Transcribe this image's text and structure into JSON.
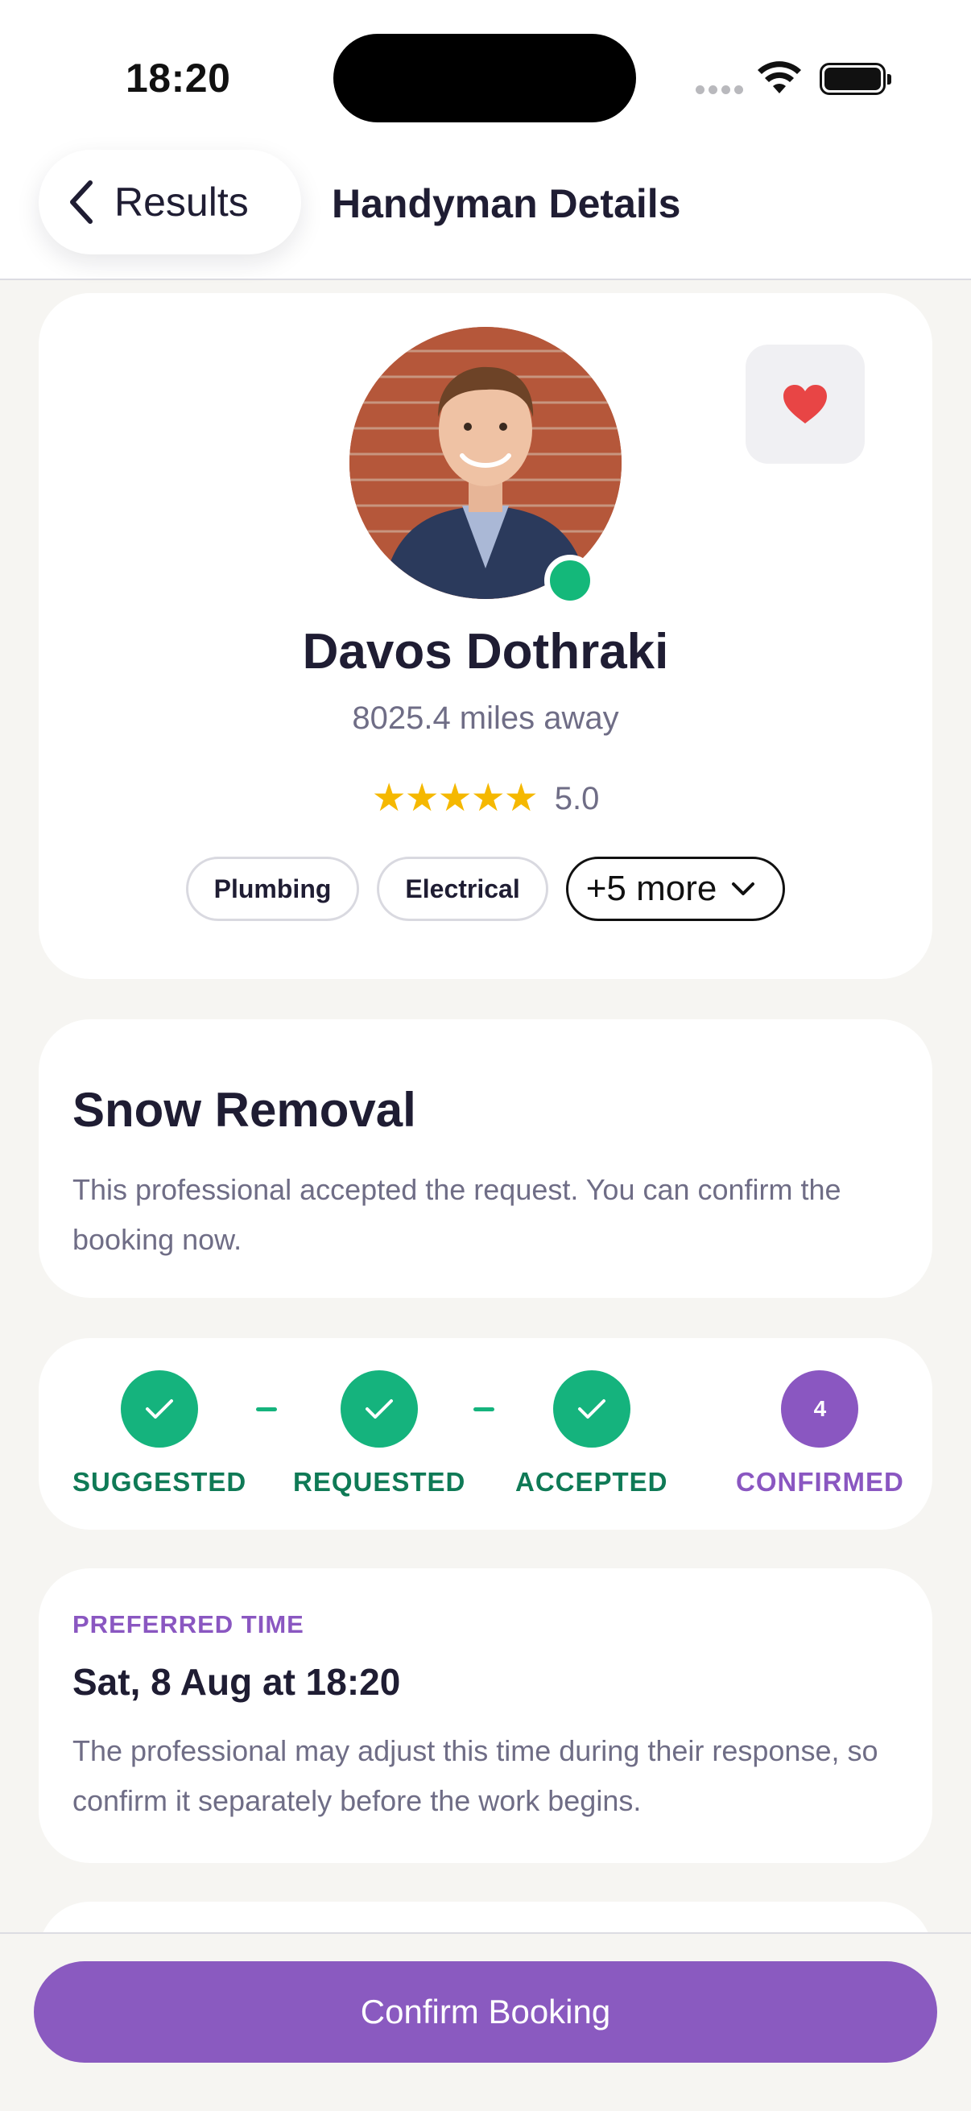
{
  "status_bar": {
    "time": "18:20"
  },
  "header": {
    "back_label": "Results",
    "title": "Handyman Details"
  },
  "profile": {
    "name": "Davos Dothraki",
    "distance": "8025.4 miles away",
    "stars": "★★★★★",
    "rating": "5.0",
    "rating_value": 5.0,
    "online": true,
    "favorited": true,
    "chips": [
      "Plumbing",
      "Electrical"
    ],
    "more_label": "+5 more"
  },
  "request": {
    "title": "Snow Removal",
    "description": "This professional accepted the request. You can confirm the booking now."
  },
  "steps": [
    {
      "label": "SUGGESTED",
      "state": "done"
    },
    {
      "label": "REQUESTED",
      "state": "done"
    },
    {
      "label": "ACCEPTED",
      "state": "done"
    },
    {
      "label": "CONFIRMED",
      "state": "current",
      "number": "4"
    }
  ],
  "preferred_time": {
    "label": "PREFERRED TIME",
    "value": "Sat, 8 Aug at 18:20",
    "note": "The professional may adjust this time during their response, so confirm it separately before the work begins."
  },
  "footer": {
    "confirm_label": "Confirm Booking"
  },
  "colors": {
    "accent": "#8a5ac0",
    "success": "#15b37d",
    "success_text": "#0f7a56",
    "favorite": "#e84545",
    "star": "#f5b800"
  }
}
